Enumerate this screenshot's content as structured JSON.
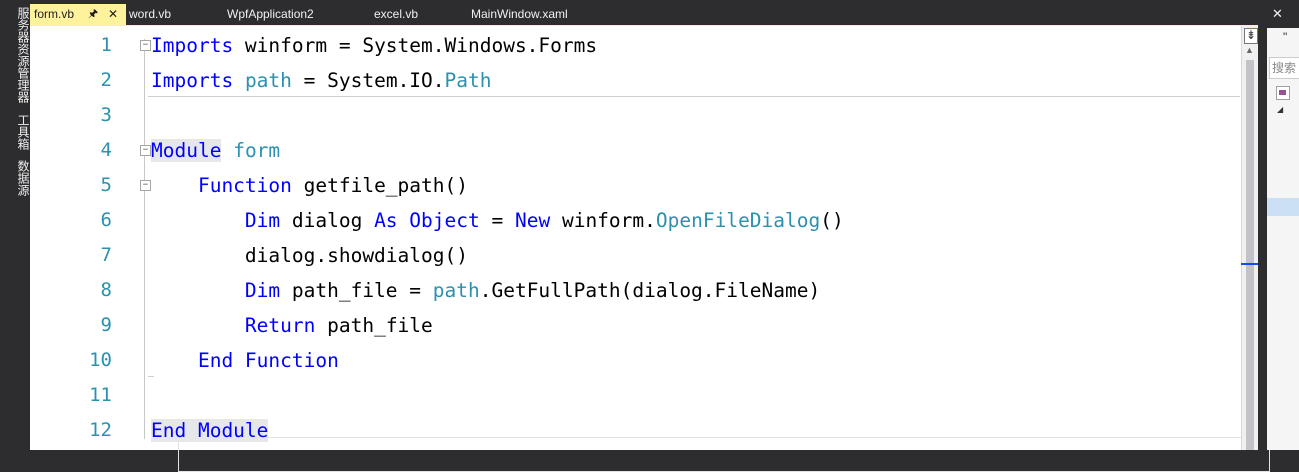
{
  "left_panel": {
    "tabs": [
      {
        "label": "服务器资源管理器"
      },
      {
        "label": "工具箱"
      },
      {
        "label": "数据源"
      }
    ]
  },
  "tabs": [
    {
      "label": "form.vb",
      "active": true
    },
    {
      "label": "word.vb"
    },
    {
      "label": "WpfApplication2"
    },
    {
      "label": "excel.vb"
    },
    {
      "label": "MainWindow.xaml"
    }
  ],
  "tab_icons": {
    "pin": "pin-icon",
    "close": "close-icon",
    "dropdown": "chevron-down-icon"
  },
  "editor": {
    "line_numbers": [
      "1",
      "2",
      "3",
      "4",
      "5",
      "6",
      "7",
      "8",
      "9",
      "10",
      "11",
      "12"
    ],
    "lines": [
      [
        {
          "t": "Imports",
          "c": "kw"
        },
        {
          "t": " winform = System.Windows.Forms",
          "c": "tx"
        }
      ],
      [
        {
          "t": "Imports",
          "c": "kw"
        },
        {
          "t": " ",
          "c": "tx"
        },
        {
          "t": "path",
          "c": "ty"
        },
        {
          "t": " = System.IO.",
          "c": "tx"
        },
        {
          "t": "Path",
          "c": "ty"
        }
      ],
      [],
      [
        {
          "t": "Module",
          "c": "kw hl"
        },
        {
          "t": " ",
          "c": "tx"
        },
        {
          "t": "form",
          "c": "ty"
        }
      ],
      [
        {
          "t": "    Function",
          "c": "kw"
        },
        {
          "t": " getfile_path()",
          "c": "tx"
        }
      ],
      [
        {
          "t": "        Dim",
          "c": "kw"
        },
        {
          "t": " dialog ",
          "c": "tx"
        },
        {
          "t": "As",
          "c": "kw"
        },
        {
          "t": " ",
          "c": "tx"
        },
        {
          "t": "Object",
          "c": "kw"
        },
        {
          "t": " = ",
          "c": "tx"
        },
        {
          "t": "New",
          "c": "kw"
        },
        {
          "t": " winform.",
          "c": "tx"
        },
        {
          "t": "OpenFileDialog",
          "c": "ty"
        },
        {
          "t": "()",
          "c": "tx"
        }
      ],
      [
        {
          "t": "        dialog.showdialog()",
          "c": "tx"
        }
      ],
      [
        {
          "t": "        Dim",
          "c": "kw"
        },
        {
          "t": " path_file = ",
          "c": "tx"
        },
        {
          "t": "path",
          "c": "ty"
        },
        {
          "t": ".GetFullPath(dialog.FileName)",
          "c": "tx"
        }
      ],
      [
        {
          "t": "        Return",
          "c": "kw"
        },
        {
          "t": " path_file",
          "c": "tx"
        }
      ],
      [
        {
          "t": "    End Function",
          "c": "kw"
        }
      ],
      [],
      [
        {
          "t": "End Module",
          "c": "kw hl"
        }
      ]
    ]
  },
  "scrollbar": {
    "split_glyph": "⇟"
  },
  "right_panel": {
    "search_placeholder": "搜索",
    "quote_glyph": "\"",
    "arrow_glyph": "◢",
    "close_glyph": "✕"
  },
  "colors": {
    "keyword": "#0000ff",
    "type": "#2b91af",
    "line_number": "#2b91af",
    "active_tab": "#fff29d",
    "chrome": "#2d2d30"
  }
}
